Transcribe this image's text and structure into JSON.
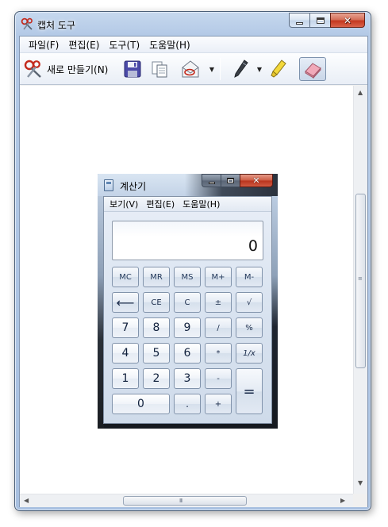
{
  "window": {
    "title": "캡처 도구"
  },
  "menubar": {
    "items": [
      "파일(F)",
      "편집(E)",
      "도구(T)",
      "도움말(H)"
    ]
  },
  "toolbar": {
    "new_label": "새로 만들기(N)",
    "buttons": [
      "scissors-icon",
      "save-icon",
      "copy-icon",
      "send-email-icon",
      "pen-icon",
      "highlighter-icon",
      "eraser-icon"
    ]
  },
  "calculator": {
    "title": "계산기",
    "menu": [
      "보기(V)",
      "편집(E)",
      "도움말(H)"
    ],
    "display": "0",
    "keys": {
      "mc": "MC",
      "mr": "MR",
      "ms": "MS",
      "mplus": "M+",
      "mminus": "M-",
      "back": "⟵",
      "ce": "CE",
      "c": "C",
      "pm": "±",
      "sqrt": "√",
      "k7": "7",
      "k8": "8",
      "k9": "9",
      "div": "/",
      "pct": "%",
      "k4": "4",
      "k5": "5",
      "k6": "6",
      "mul": "*",
      "recip": "1/x",
      "k1": "1",
      "k2": "2",
      "k3": "3",
      "sub": "-",
      "eq": "=",
      "k0": "0",
      "dot": ".",
      "add": "+"
    }
  },
  "scrollbars": {
    "vertical_grip": "≡",
    "horizontal_grip": "III"
  }
}
